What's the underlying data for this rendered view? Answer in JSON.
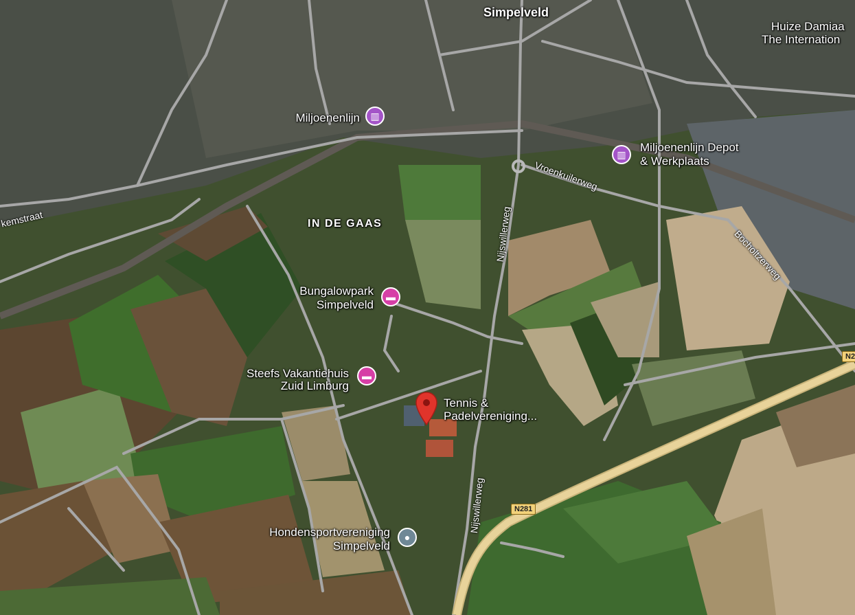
{
  "map": {
    "places": {
      "town": "Simpelveld",
      "neighborhood": "IN DE GAAS",
      "huize_line1": "Huize Damiaa",
      "huize_line2": "The Internation"
    },
    "pois": {
      "miljoenenlijn": "Miljoenenlijn",
      "depot_line1": "Miljoenenlijn Depot",
      "depot_line2": "& Werkplaats",
      "bungalow_line1": "Bungalowpark",
      "bungalow_line2": "Simpelveld",
      "steefs_line1": "Steefs Vakantiehuis",
      "steefs_line2": "Zuid Limburg",
      "tennis_line1": "Tennis &",
      "tennis_line2": "Padelvereniging...",
      "honden_line1": "Hondensportvereniging",
      "honden_line2": "Simpelveld"
    },
    "roads": {
      "nijswillerweg_north": "Nijswillerweg",
      "nijswillerweg_south": "Nijswillerweg",
      "vroenkuilerweg": "Vroenkuilerweg",
      "bocholtzerweg": "Bocholtzerweg",
      "westmost_street": "kemstraat"
    },
    "shields": {
      "n281_main": "N281",
      "n281_edge": "N2"
    },
    "icons": {
      "museum": "museum-icon",
      "hotel": "hotel-bed-icon",
      "sport": "sports-club-icon",
      "selected": "red-location-pin-icon"
    },
    "colors": {
      "museum_pin": "#a454c8",
      "hotel_pin": "#d63fa6",
      "sport_pin": "#6f8896",
      "selected_pin": "#e0342b",
      "highway": "#e8d39a"
    }
  }
}
